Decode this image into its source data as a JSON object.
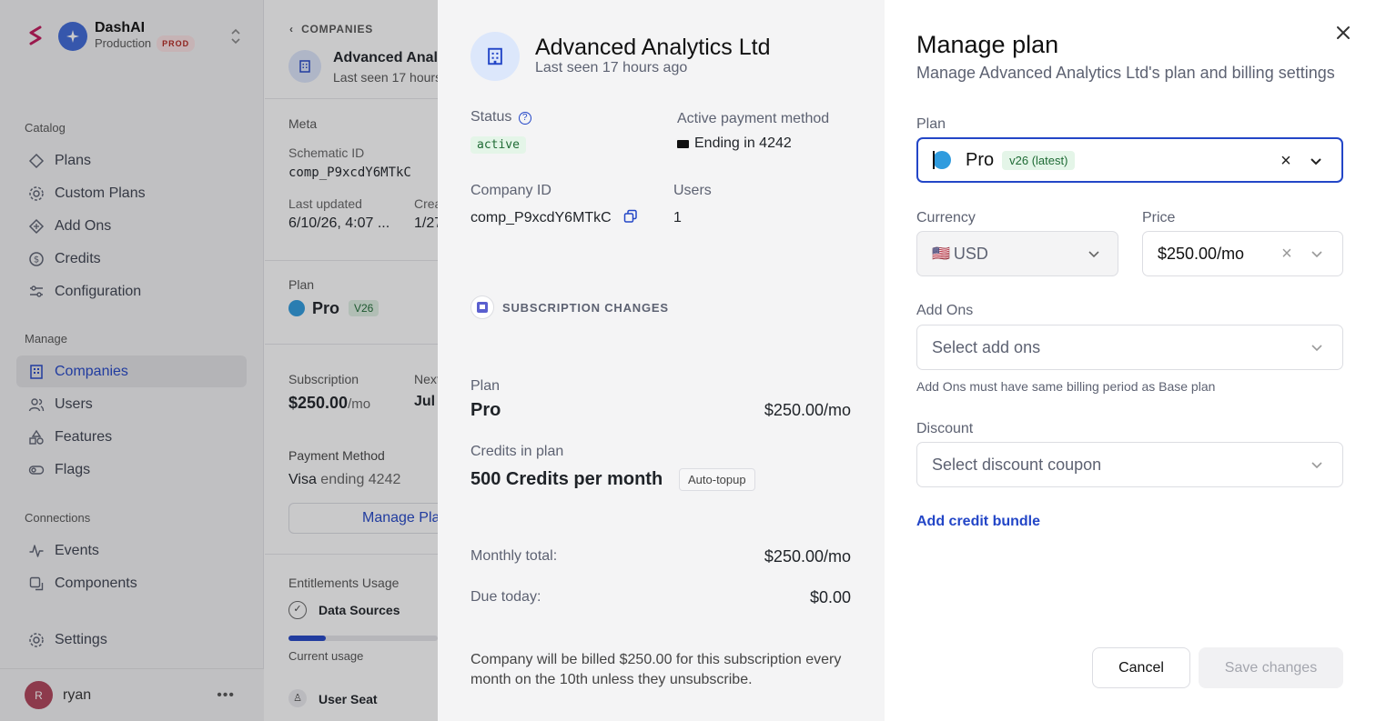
{
  "sidebar": {
    "workspace_name": "DashAI",
    "workspace_env": "Production",
    "env_badge": "PROD",
    "sections": {
      "catalog": "Catalog",
      "manage": "Manage",
      "connections": "Connections"
    },
    "catalog_items": [
      {
        "label": "Plans",
        "icon": "diamond-icon"
      },
      {
        "label": "Custom Plans",
        "icon": "gear-icon"
      },
      {
        "label": "Add Ons",
        "icon": "diamond-plus-icon"
      },
      {
        "label": "Credits",
        "icon": "dollar-circle-icon"
      },
      {
        "label": "Configuration",
        "icon": "sliders-icon"
      }
    ],
    "manage_items": [
      {
        "label": "Companies",
        "icon": "building-icon",
        "active": true
      },
      {
        "label": "Users",
        "icon": "users-icon"
      },
      {
        "label": "Features",
        "icon": "shapes-icon"
      },
      {
        "label": "Flags",
        "icon": "toggle-icon"
      }
    ],
    "connection_items": [
      {
        "label": "Events",
        "icon": "activity-icon"
      },
      {
        "label": "Components",
        "icon": "component-icon"
      }
    ],
    "settings_label": "Settings",
    "user": {
      "initial": "R",
      "name": "ryan"
    }
  },
  "company_page": {
    "breadcrumb": "COMPANIES",
    "name": "Advanced Analy",
    "last_seen": "Last seen 17 hours",
    "meta_heading": "Meta",
    "schematic_id_label": "Schematic ID",
    "schematic_id": "comp_P9xcdY6MTkC",
    "last_updated_label": "Last updated",
    "last_updated": "6/10/26, 4:07 ...",
    "created_label": "Crea",
    "created": "1/27",
    "plan_label": "Plan",
    "plan_name": "Pro",
    "plan_version": "V26",
    "subscription_label": "Subscription",
    "subscription_amount": "$250.00",
    "subscription_unit": "/mo",
    "next_label": "Next",
    "next_value": "Jul",
    "payment_method_label": "Payment Method",
    "payment_brand": "Visa",
    "payment_rest": " ending 4242",
    "manage_button": "Manage Pla",
    "entitlements_label": "Entitlements Usage",
    "entitlement_1": "Data Sources",
    "current_usage": "Current usage",
    "entitlement_2": "User Seat",
    "usage_fraction": 0.25
  },
  "summary": {
    "company_name": "Advanced Analytics Ltd",
    "last_seen": "Last seen 17 hours ago",
    "status_label": "Status",
    "status_value": "active",
    "payment_label": "Active payment method",
    "payment_value": "Ending in 4242",
    "company_id_label": "Company ID",
    "company_id": "comp_P9xcdY6MTkC",
    "users_label": "Users",
    "users_value": "1",
    "changes_heading": "SUBSCRIPTION CHANGES",
    "plan_label": "Plan",
    "plan_name": "Pro",
    "plan_price": "$250.00/mo",
    "credits_label": "Credits in plan",
    "credits_value": "500 Credits per month",
    "auto_topup": "Auto-topup",
    "monthly_total_label": "Monthly total:",
    "monthly_total": "$250.00/mo",
    "due_today_label": "Due today:",
    "due_today": "$0.00",
    "billing_note_1": "Company will be billed $250.00 for this subscription every",
    "billing_note_2": "month on the 10th unless they unsubscribe."
  },
  "manage_plan": {
    "title": "Manage plan",
    "subtitle": "Manage Advanced Analytics Ltd's plan and billing settings",
    "plan_label": "Plan",
    "plan_value": "Pro",
    "plan_version": "v26 (latest)",
    "currency_label": "Currency",
    "currency_flag": "🇺🇸",
    "currency_value": "USD",
    "price_label": "Price",
    "price_value": "$250.00/mo",
    "addons_label": "Add Ons",
    "addons_placeholder": "Select add ons",
    "addons_hint": "Add Ons must have same billing period as Base plan",
    "discount_label": "Discount",
    "discount_placeholder": "Select discount coupon",
    "add_credit_bundle": "Add credit bundle",
    "cancel": "Cancel",
    "save": "Save changes"
  },
  "colors": {
    "accent": "#2346c7",
    "active_bg": "#e4f5e8",
    "active_fg": "#1f6b35",
    "plan_dot": "#2f9bde"
  }
}
